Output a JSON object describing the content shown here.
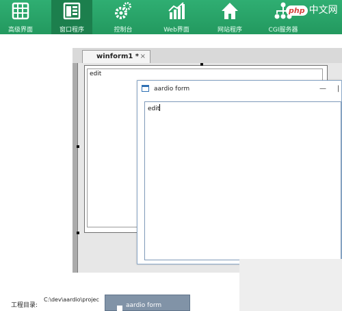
{
  "toolbar": {
    "items": [
      {
        "label": "高级界面",
        "icon": "grid-icon"
      },
      {
        "label": "窗口程序",
        "icon": "window-icon"
      },
      {
        "label": "控制台",
        "icon": "gears-icon"
      },
      {
        "label": "Web界面",
        "icon": "bar-chart-icon"
      },
      {
        "label": "网站程序",
        "icon": "house-icon"
      },
      {
        "label": "CGI服务器",
        "icon": "network-icon"
      }
    ],
    "active_item": "窗口程序",
    "logo_text": "中文网",
    "logo_badge": "php"
  },
  "designer": {
    "tab_label": "winform1 *",
    "tab_close": "×",
    "edit_text": "edit"
  },
  "aardio_form": {
    "title": "aardio form",
    "minimize_glyph": "—",
    "close_glyph": "|",
    "edit_text": "edit"
  },
  "project": {
    "label": "工程目录:",
    "path": "C:\\dev\\aardio\\projec",
    "task_button": "aardio form"
  },
  "colors": {
    "toolbar": "#27a366",
    "toolbar_active": "#1c7f4d",
    "taskbar": "#8193a7"
  }
}
